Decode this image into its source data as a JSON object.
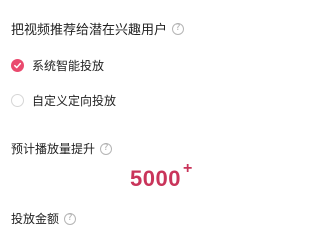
{
  "header": {
    "title": "把视频推荐给潜在兴趣用户",
    "help_glyph": "?"
  },
  "options": [
    {
      "label": "系统智能投放",
      "selected": true
    },
    {
      "label": "自定义定向投放",
      "selected": false
    }
  ],
  "estimate": {
    "label": "预计播放量提升",
    "help_glyph": "?",
    "value": "5000",
    "suffix": "+"
  },
  "amount": {
    "label": "投放金额",
    "help_glyph": "?"
  },
  "colors": {
    "accent": "#ea4a6e",
    "number": "#c9345a"
  }
}
